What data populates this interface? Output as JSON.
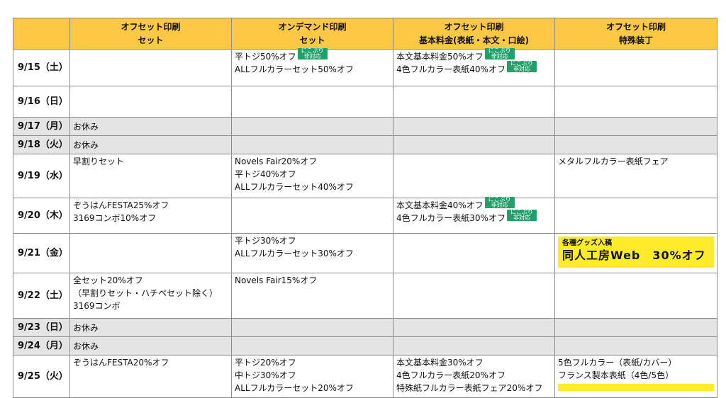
{
  "headers": [
    [
      "",
      ""
    ],
    [
      "オフセット印刷",
      "セット"
    ],
    [
      "オンデマンド印刷",
      "セット"
    ],
    [
      "オフセット印刷",
      "基本料金(表紙・本文・口絵)"
    ],
    [
      "オフセット印刷",
      "特殊装丁"
    ]
  ],
  "badge_text": [
    "にこぷり",
    "非対応"
  ],
  "rows": [
    {
      "date": "9/15（土）",
      "c1": [],
      "c2": [
        {
          "t": "平トジ50%オフ",
          "b": true
        },
        {
          "t": "ALLフルカラーセット50%オフ"
        }
      ],
      "c3": [
        {
          "t": "本文基本料金50%オフ",
          "b": true
        },
        {
          "t": "4色フルカラー表紙40%オフ",
          "b": true
        }
      ],
      "c4": []
    },
    {
      "date": "9/16（日）",
      "c1": [],
      "c2": [],
      "c3": [],
      "c4": []
    },
    {
      "date": "9/17（月）",
      "closed": true,
      "c1": [
        {
          "t": "お休み"
        }
      ],
      "c2": [],
      "c3": [],
      "c4": []
    },
    {
      "date": "9/18（火）",
      "closed": true,
      "c1": [
        {
          "t": "お休み"
        }
      ],
      "c2": [],
      "c3": [],
      "c4": []
    },
    {
      "date": "9/19（水）",
      "c1": [
        {
          "t": "早割りセット"
        }
      ],
      "c2": [
        {
          "t": "Novels Fair20%オフ"
        },
        {
          "t": "平トジ40%オフ"
        },
        {
          "t": "ALLフルカラーセット40%オフ"
        }
      ],
      "c3": [],
      "c4": [
        {
          "t": "メタルフルカラー表紙フェア"
        }
      ]
    },
    {
      "date": "9/20（木）",
      "c1": [
        {
          "t": "ぞうはんFESTA25%オフ"
        },
        {
          "t": "3169コンボ10%オフ"
        }
      ],
      "c2": [],
      "c3": [
        {
          "t": "本文基本料金40%オフ",
          "b": true
        },
        {
          "t": "4色フルカラー表紙30%オフ",
          "b": true
        }
      ],
      "c4": []
    },
    {
      "date": "9/21（金）",
      "c1": [],
      "c2": [
        {
          "t": "平トジ30%オフ"
        },
        {
          "t": "ALLフルカラーセット30%オフ"
        }
      ],
      "c3": [],
      "c4": [],
      "banner": {
        "sub": "各種グッズ入稿",
        "main": "同人工房Web　30%オフ"
      }
    },
    {
      "date": "9/22（土）",
      "c1": [
        {
          "t": "全セット20%オフ"
        },
        {
          "t": "（早割りセット・ハチペセット除く）"
        },
        {
          "t": "3169コンボ"
        }
      ],
      "c2": [
        {
          "t": "Novels Fair15%オフ"
        }
      ],
      "c3": [],
      "c4": []
    },
    {
      "date": "9/23（日）",
      "closed": true,
      "c1": [
        {
          "t": "お休み"
        }
      ],
      "c2": [],
      "c3": [],
      "c4": []
    },
    {
      "date": "9/24（月）",
      "closed": true,
      "c1": [
        {
          "t": "お休み"
        }
      ],
      "c2": [],
      "c3": [],
      "c4": []
    },
    {
      "date": "9/25（火）",
      "c1": [
        {
          "t": "ぞうはんFESTA20%オフ"
        }
      ],
      "c2": [
        {
          "t": "平トジ20%オフ"
        },
        {
          "t": "中トジ30%オフ"
        },
        {
          "t": "ALLフルカラーセット20%オフ"
        }
      ],
      "c3": [
        {
          "t": "本文基本料金30%オフ"
        },
        {
          "t": "4色フルカラー表紙20%オフ"
        },
        {
          "t": "特殊紙フルカラー表紙フェア20%オフ"
        }
      ],
      "c4": [
        {
          "t": "5色フルカラー（表紙/カバー）"
        },
        {
          "t": "フランス製本表紙（4色/5色）"
        }
      ],
      "partial_banner": true
    }
  ],
  "colors": {
    "header_bg": "#fdc843",
    "closed_bg": "#e4e4e4",
    "badge_bg": "#23a06a",
    "banner_bg": "#ffeb2a"
  }
}
